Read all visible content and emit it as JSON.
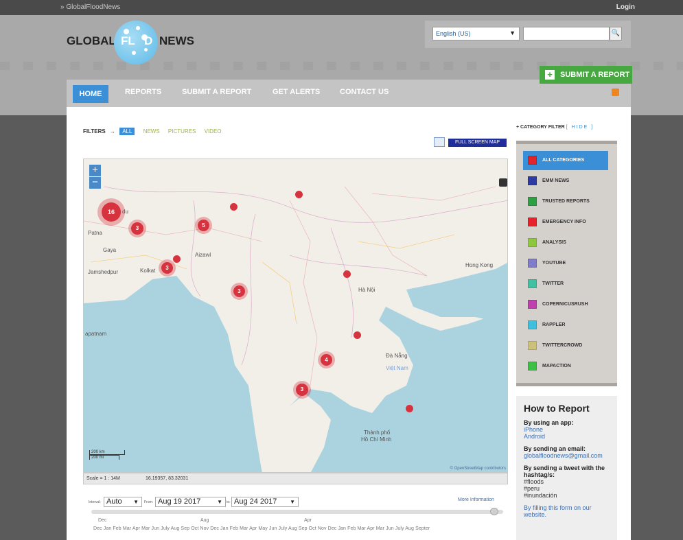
{
  "topbar": {
    "site": "GlobalFloodNews",
    "login": "Login"
  },
  "logo": {
    "left": "GLOBAL",
    "mid1": "FL",
    "mid2": "D",
    "right": "NEWS"
  },
  "language": {
    "selected": "English (US)"
  },
  "search": {
    "placeholder": ""
  },
  "submit_button": "SUBMIT A REPORT",
  "nav": {
    "home": "HOME",
    "reports": "REPORTS",
    "submit": "SUBMIT A REPORT",
    "alerts": "GET ALERTS",
    "contact": "CONTACT US"
  },
  "filters": {
    "label": "FILTERS",
    "all": "ALL",
    "news": "NEWS",
    "pictures": "PICTURES",
    "video": "VIDEO"
  },
  "fullscreen": "FULL SCREEN MAP",
  "map": {
    "markers": [
      {
        "count": "16",
        "size": "large"
      },
      {
        "count": "3",
        "size": "medium"
      },
      {
        "count": "5",
        "size": "medium"
      },
      {
        "count": "3",
        "size": "medium"
      },
      {
        "count": "3",
        "size": "medium"
      },
      {
        "count": "4",
        "size": "medium"
      },
      {
        "count": "3",
        "size": "medium"
      }
    ],
    "labels": {
      "patna": "Patna",
      "gaya": "Gaya",
      "jamshedpur": "Jamshedpur",
      "kolkata": "Kolkat",
      "aizawl": "Aizawl",
      "hanoi": "Hà Nội",
      "danang": "Đà Nẵng",
      "vietnam": "Việt Nam",
      "hongkong": "Hong Kong",
      "hcm1": "Thành phố",
      "hcm2": "Hồ Chí Minh",
      "apatnam": "apatnam",
      "du": "du"
    },
    "scale_km": "200 km",
    "scale_mi": "200 mi",
    "attribution": "© OpenStreetMap contributors",
    "scale_text": "Scale = 1 : 14M",
    "coords": "16.19357, 83.32031"
  },
  "timeline": {
    "interval_label": "Interval:",
    "interval_value": "Auto",
    "from_label": "From:",
    "from_value": "Aug 19 2017",
    "to_label": "to:",
    "to_value": "Aug 24 2017",
    "more_info": "More Information",
    "years": [
      "Dec",
      "Aug",
      "Apr"
    ],
    "months": "Dec Jan  Feb  Mar  Apr  Mar  Jun  July  Aug  Sep  Oct  Nov  Dec  Jan  Feb  Mar  Apr  May  Jun  July  Aug  Sep  Oct  Nov  Dec  Jan  Feb  Mar  Apr  Mar  Jun  July  Aug  Septer"
  },
  "category_filter": {
    "title": "CATEGORY FILTER",
    "hide": "[ HIDE ]",
    "items": [
      {
        "label": "ALL CATEGORIES",
        "color": "#e0252b"
      },
      {
        "label": "EMM NEWS",
        "color": "#2f3ba5"
      },
      {
        "label": "TRUSTED REPORTS",
        "color": "#2ea043"
      },
      {
        "label": "EMERGENCY INFO",
        "color": "#e8222c"
      },
      {
        "label": "ANALYSIS",
        "color": "#8ec63f"
      },
      {
        "label": "YOUTUBE",
        "color": "#7d7dc9"
      },
      {
        "label": "TWITTER",
        "color": "#41c0a2"
      },
      {
        "label": "COPERNICUSRUSH",
        "color": "#c040b0"
      },
      {
        "label": "RAPPLER",
        "color": "#3cc0de"
      },
      {
        "label": "TWITTERCROWD",
        "color": "#ccc07a"
      },
      {
        "label": "MAPACTION",
        "color": "#3cbf45"
      }
    ]
  },
  "howto": {
    "title": "How to Report",
    "app_label": "By using an app:",
    "app_iphone": "iPhone",
    "app_android": "Android",
    "email_label": "By sending an email:",
    "email": "globalfloodnews@gmail.com",
    "tweet_label": "By sending a tweet with the hashtag/s:",
    "tag1": "#floods",
    "tag2": "#peru",
    "tag3": "#inundación",
    "form_link": "By filling this form on our website."
  }
}
